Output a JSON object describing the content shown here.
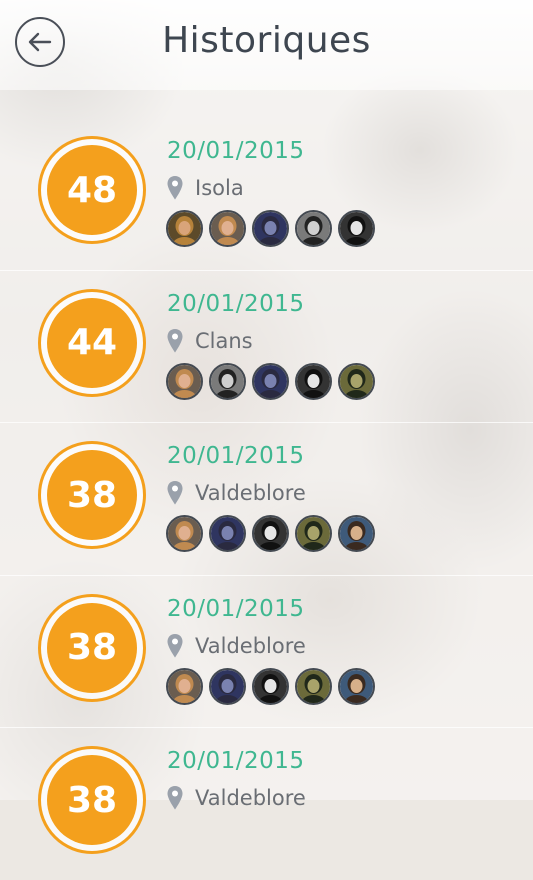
{
  "header": {
    "title": "Historiques",
    "back_icon": "arrow-left-icon"
  },
  "history": [
    {
      "score": "48",
      "date": "20/01/2015",
      "place": "Isola",
      "avatars": [
        {
          "bg": "#5c4a2a",
          "skin": "#d9a47a",
          "hair": "#b6823a"
        },
        {
          "bg": "#6a5d50",
          "skin": "#e0b090",
          "hair": "#c08a50"
        },
        {
          "bg": "#2f3560",
          "skin": "#7a82b0",
          "hair": "#2a2a40"
        },
        {
          "bg": "#7a7a7a",
          "skin": "#cfcfcf",
          "hair": "#222222"
        },
        {
          "bg": "#333333",
          "skin": "#e6e6e6",
          "hair": "#111111"
        }
      ]
    },
    {
      "score": "44",
      "date": "20/01/2015",
      "place": "Clans",
      "avatars": [
        {
          "bg": "#6a5d50",
          "skin": "#e0b090",
          "hair": "#c08a50"
        },
        {
          "bg": "#7a7a7a",
          "skin": "#cfcfcf",
          "hair": "#222222"
        },
        {
          "bg": "#2f3560",
          "skin": "#7a82b0",
          "hair": "#2a2a40"
        },
        {
          "bg": "#333333",
          "skin": "#e6e6e6",
          "hair": "#111111"
        },
        {
          "bg": "#6b6a3a",
          "skin": "#a8a36a",
          "hair": "#20281a"
        }
      ]
    },
    {
      "score": "38",
      "date": "20/01/2015",
      "place": "Valdeblore",
      "avatars": [
        {
          "bg": "#6a5d50",
          "skin": "#e0b090",
          "hair": "#c08a50"
        },
        {
          "bg": "#2f3560",
          "skin": "#7a82b0",
          "hair": "#2a2a40"
        },
        {
          "bg": "#333333",
          "skin": "#e6e6e6",
          "hair": "#111111"
        },
        {
          "bg": "#6b6a3a",
          "skin": "#a8a36a",
          "hair": "#20281a"
        },
        {
          "bg": "#3e5a7a",
          "skin": "#d7b08a",
          "hair": "#3a2a20"
        }
      ]
    },
    {
      "score": "38",
      "date": "20/01/2015",
      "place": "Valdeblore",
      "avatars": [
        {
          "bg": "#6a5d50",
          "skin": "#e0b090",
          "hair": "#c08a50"
        },
        {
          "bg": "#2f3560",
          "skin": "#7a82b0",
          "hair": "#2a2a40"
        },
        {
          "bg": "#333333",
          "skin": "#e6e6e6",
          "hair": "#111111"
        },
        {
          "bg": "#6b6a3a",
          "skin": "#a8a36a",
          "hair": "#20281a"
        },
        {
          "bg": "#3e5a7a",
          "skin": "#d7b08a",
          "hair": "#3a2a20"
        }
      ]
    },
    {
      "score": "38",
      "date": "20/01/2015",
      "place": "Valdeblore",
      "avatars": []
    }
  ],
  "colors": {
    "accent_orange": "#f4a01d",
    "date_green": "#3fb790",
    "title_gray": "#3e4650",
    "place_gray": "#6a6e74"
  }
}
